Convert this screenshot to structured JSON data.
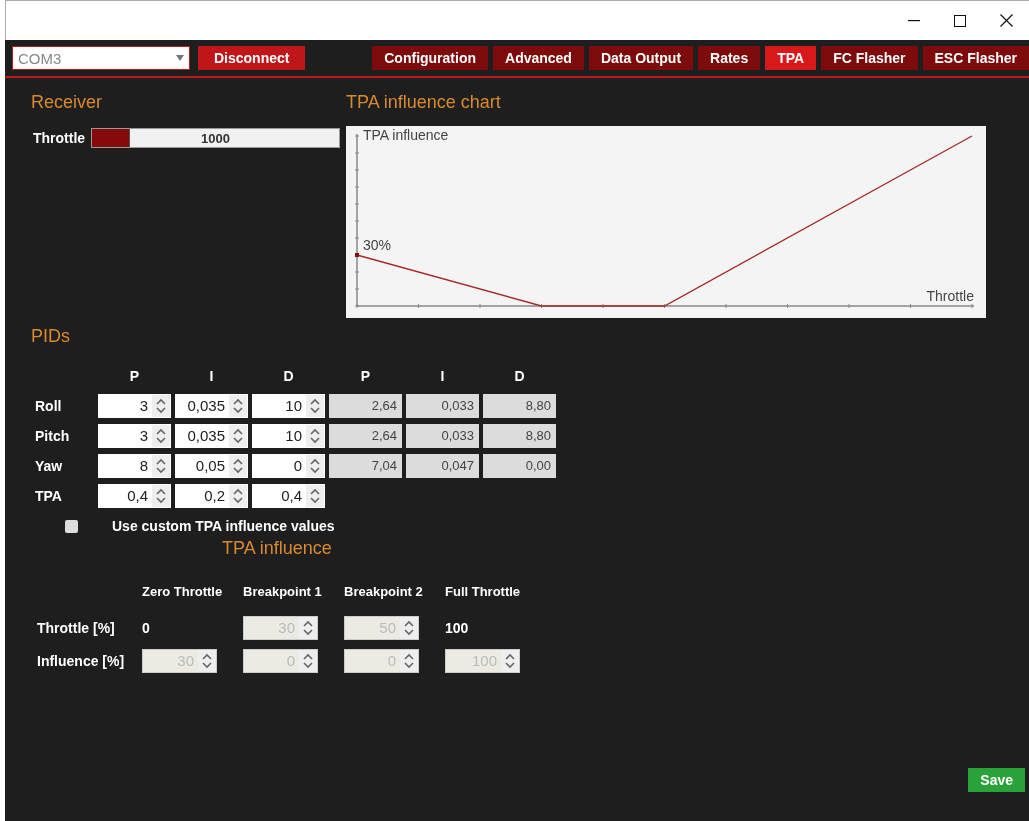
{
  "toolbar": {
    "port": {
      "value": "COM3"
    },
    "connect_button": "Disconnect",
    "tabs": [
      {
        "label": "Configuration",
        "selected": false
      },
      {
        "label": "Advanced",
        "selected": false
      },
      {
        "label": "Data Output",
        "selected": false
      },
      {
        "label": "Rates",
        "selected": false
      },
      {
        "label": "TPA",
        "selected": true
      },
      {
        "label": "FC Flasher",
        "selected": false
      },
      {
        "label": "ESC Flasher",
        "selected": false
      }
    ]
  },
  "receiver": {
    "title": "Receiver",
    "channels": [
      {
        "name": "Throttle",
        "level": 0.15,
        "reading": "1000"
      }
    ]
  },
  "chart_panel": {
    "title": "TPA influence chart",
    "y_label": "TPA influence",
    "x_label": "Throttle",
    "point_label": "30%"
  },
  "pids": {
    "title": "PIDs",
    "columns": [
      "P",
      "I",
      "D",
      "P",
      "I",
      "D"
    ],
    "rows": [
      {
        "name": "Roll",
        "inputs": [
          "3",
          "0,035",
          "10"
        ],
        "computed": [
          "2,64",
          "0,033",
          "8,80"
        ]
      },
      {
        "name": "Pitch",
        "inputs": [
          "3",
          "0,035",
          "10"
        ],
        "computed": [
          "2,64",
          "0,033",
          "8,80"
        ]
      },
      {
        "name": "Yaw",
        "inputs": [
          "8",
          "0,05",
          "0"
        ],
        "computed": [
          "7,04",
          "0,047",
          "0,00"
        ]
      },
      {
        "name": "TPA",
        "inputs": [
          "0,4",
          "0,2",
          "0,4"
        ]
      }
    ],
    "custom_values": {
      "label": "Use custom TPA influence values",
      "checked": false
    }
  },
  "tpa_influence": {
    "title": "TPA influence",
    "columns": [
      "Zero Throttle",
      "Breakpoint 1",
      "Breakpoint 2",
      "Full Throttle"
    ],
    "rows": [
      {
        "name": "Throttle [%]",
        "cells": [
          {
            "kind": "text",
            "value": "0"
          },
          {
            "kind": "spin",
            "value": "30",
            "disabled": true
          },
          {
            "kind": "spin",
            "value": "50",
            "disabled": true
          },
          {
            "kind": "text",
            "value": "100"
          }
        ]
      },
      {
        "name": "Influence [%]",
        "cells": [
          {
            "kind": "spin",
            "value": "30",
            "disabled": true
          },
          {
            "kind": "spin",
            "value": "0",
            "disabled": true
          },
          {
            "kind": "spin",
            "value": "0",
            "disabled": true
          },
          {
            "kind": "spin",
            "value": "100",
            "disabled": true
          }
        ]
      }
    ]
  },
  "save_button": "Save"
}
